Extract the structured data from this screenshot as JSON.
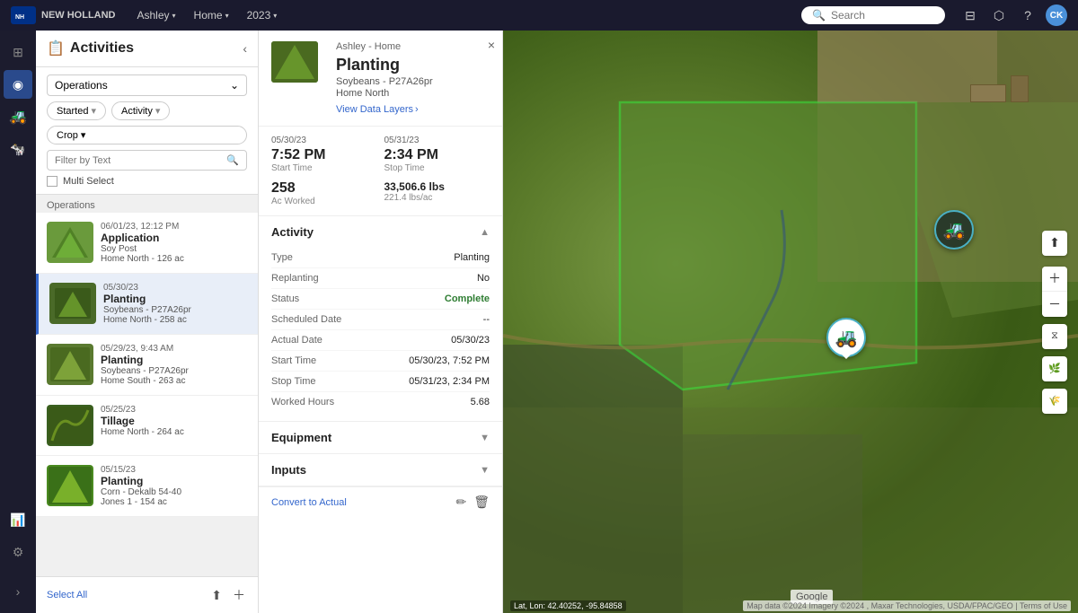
{
  "topNav": {
    "user": "Ashley",
    "userInitials": "CK",
    "home": "Home",
    "year": "2023",
    "searchPlaceholder": "Search"
  },
  "sidebar": {
    "icons": [
      {
        "name": "grid-icon",
        "symbol": "⊞",
        "active": false
      },
      {
        "name": "map-icon",
        "symbol": "◉",
        "active": true
      },
      {
        "name": "tractor-icon",
        "symbol": "🚜",
        "active": false
      },
      {
        "name": "livestock-icon",
        "symbol": "🐄",
        "active": false
      },
      {
        "name": "chart-icon",
        "symbol": "📊",
        "active": false
      },
      {
        "name": "settings-icon",
        "symbol": "⚙",
        "active": false
      }
    ]
  },
  "activitiesPanel": {
    "title": "Activities",
    "filterLabel": "Operations",
    "startedLabel": "Started",
    "activityFilterLabel": "Activity",
    "cropLabel": "Crop",
    "filterPlaceholder": "Filter by Text",
    "multiSelectLabel": "Multi Select",
    "operationsGroupLabel": "Operations",
    "items": [
      {
        "date": "06/01/23, 12:12 PM",
        "name": "Application",
        "sub1": "Soy Post",
        "sub2": "Home North - 126 ac",
        "color": "#6a9a3c",
        "selected": false
      },
      {
        "date": "05/30/23",
        "name": "Planting",
        "sub1": "Soybeans - P27A26pr",
        "sub2": "Home North - 258 ac",
        "color": "#5a8a30",
        "selected": true
      },
      {
        "date": "05/29/23, 9:43 AM",
        "name": "Planting",
        "sub1": "Soybeans - P27A26pr",
        "sub2": "Home South - 263 ac",
        "color": "#7a9a45",
        "selected": false
      },
      {
        "date": "05/25/23",
        "name": "Tillage",
        "sub1": "Home North - 264 ac",
        "sub2": "",
        "color": "#5a8a30",
        "selected": false
      },
      {
        "date": "05/15/23",
        "name": "Planting",
        "sub1": "Corn - Dekalb 54-40",
        "sub2": "Jones 1 - 154 ac",
        "color": "#4a9a20",
        "selected": false
      }
    ],
    "selectAllLabel": "Select All"
  },
  "detailPanel": {
    "breadcrumb": "Ashley - Home",
    "title": "Planting",
    "subtitle": "Soybeans - P27A26pr",
    "location": "Home North",
    "viewDataLayersLabel": "View Data Layers",
    "closeLabel": "×",
    "stats": {
      "startTime": "7:52 PM",
      "startDate": "05/30/23",
      "startLabel": "Start Time",
      "stopTime": "2:34 PM",
      "stopDate": "05/31/23",
      "stopLabel": "Stop Time",
      "acWorked": "258",
      "acWorkedLabel": "Ac Worked",
      "weight": "33,506.6 lbs",
      "weightSub": "221.4 lbs/ac",
      "weightLabel": ""
    },
    "activitySection": {
      "title": "Activity",
      "rows": [
        {
          "label": "Type",
          "value": "Planting"
        },
        {
          "label": "Replanting",
          "value": "No"
        },
        {
          "label": "Status",
          "value": "Complete",
          "isStatus": true
        },
        {
          "label": "Scheduled Date",
          "value": "--"
        },
        {
          "label": "Actual Date",
          "value": "05/30/23"
        },
        {
          "label": "Start Time",
          "value": "05/30/23, 7:52 PM"
        },
        {
          "label": "Stop Time",
          "value": "05/31/23, 2:34 PM"
        },
        {
          "label": "Worked Hours",
          "value": "5.68"
        }
      ]
    },
    "equipmentSection": {
      "title": "Equipment"
    },
    "inputsSection": {
      "title": "Inputs"
    },
    "footer": {
      "convertLabel": "Convert to Actual"
    }
  },
  "map": {
    "coords": "Lat, Lon: 42.40252, -95.84858",
    "attribution": "Map data ©2024 Imagery ©2024 , Maxar Technologies, USDA/FPAC/GEO | Terms of Use",
    "googleLabel": "Google"
  }
}
